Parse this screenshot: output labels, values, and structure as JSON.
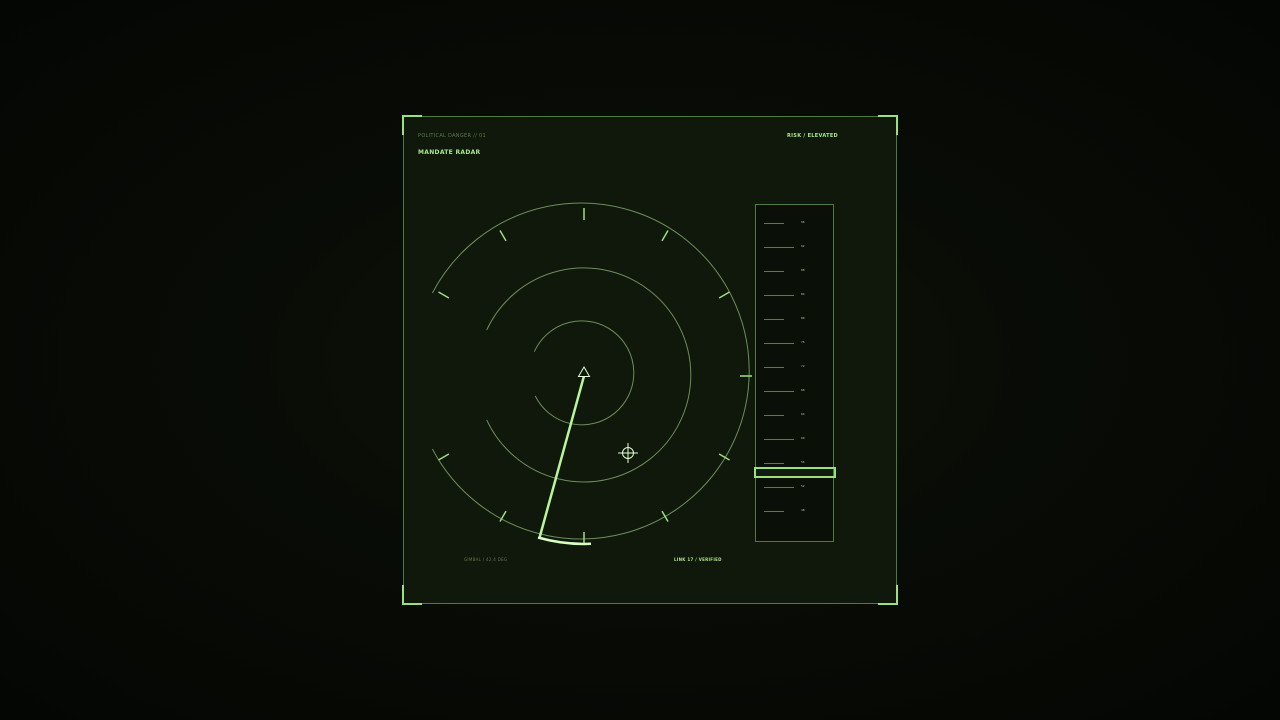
{
  "panel": {
    "kicker": "POLITICAL DANGER // 01",
    "title": "MANDATE RADAR",
    "status": "RISK / ELEVATED",
    "footer_left": "GIMBAL / 42.4 DEG",
    "footer_right": "LINK 17 / VERIFIED"
  },
  "scale": {
    "ticks": [
      "96",
      "92",
      "88",
      "84",
      "80",
      "76",
      "72",
      "68",
      "64",
      "60",
      "56",
      "52",
      "48",
      "44"
    ],
    "marker_value": 50
  },
  "colors": {
    "accent": "#9be07d",
    "dim": "#5d7a4a",
    "panel": "#10170b"
  },
  "icons": [
    "crosshair-icon",
    "heading-triangle-icon"
  ]
}
